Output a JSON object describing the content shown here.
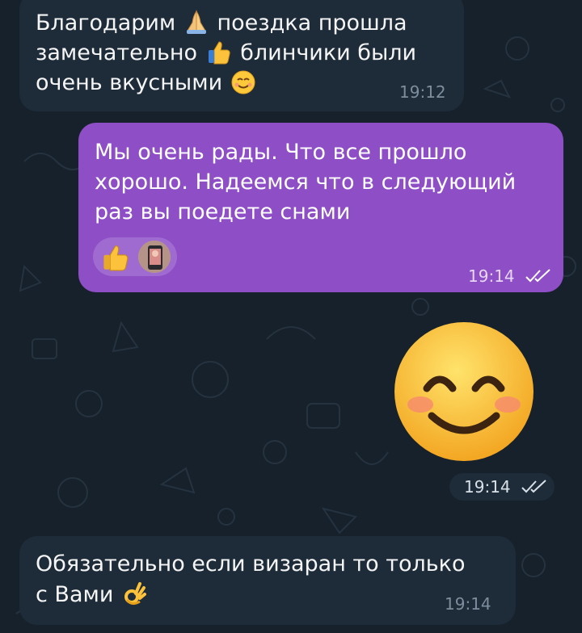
{
  "messages": [
    {
      "direction": "incoming",
      "lines": [
        [
          "Благодарим",
          "pray-emoji",
          "поездка прошла"
        ],
        [
          "замечательно",
          "thumbs-up-emoji",
          "блинчики были"
        ],
        [
          "очень вкусными",
          "smiling-face-emoji",
          ""
        ]
      ],
      "time": "19:12"
    },
    {
      "direction": "outgoing",
      "lines": [
        "Мы очень рады. Что все прошло",
        "хорошо. Надеемся что в следующий",
        "раз вы поедете снами"
      ],
      "reactions": [
        "thumbs-up-emoji",
        "avatar"
      ],
      "time": "19:14",
      "status": "read-double-check-icon"
    },
    {
      "direction": "outgoing",
      "type": "sticker",
      "sticker": "smiling-face-emoji",
      "time": "19:14",
      "status": "read-double-check-icon"
    },
    {
      "direction": "incoming",
      "lines": [
        [
          "Обязательно если визаран то только"
        ],
        [
          "с Вами",
          "ok-hand-emoji"
        ]
      ],
      "time": "19:14"
    }
  ],
  "colors": {
    "background": "#17212b",
    "incoming_bubble": "#1e2c3a",
    "outgoing_bubble": "#8e4ec6"
  }
}
